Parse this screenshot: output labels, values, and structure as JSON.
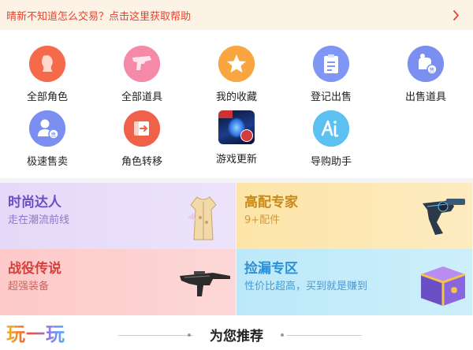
{
  "banner": {
    "text": "晴新不知道怎么交易？点击这里获取帮助",
    "icon": "chevron-right-icon"
  },
  "grid_items": [
    {
      "label": "全部角色",
      "icon": "character-icon",
      "color": "#f56a4a"
    },
    {
      "label": "全部道具",
      "icon": "gun-icon",
      "color": "#f48aa8"
    },
    {
      "label": "我的收藏",
      "icon": "star-icon",
      "color": "#f9a640"
    },
    {
      "label": "登记出售",
      "icon": "clipboard-icon",
      "color": "#7f96f4"
    },
    {
      "label": "出售道具",
      "icon": "bag-sell-icon",
      "color": "#7a8ff0"
    },
    {
      "label": "极速售卖",
      "icon": "user-sell-icon",
      "color": "#7a8ff0"
    },
    {
      "label": "角色转移",
      "icon": "transfer-icon",
      "color": "#f0614a"
    },
    {
      "label": "游戏更新",
      "icon": "game-thumbnail-icon",
      "color": "#1b3d8a"
    },
    {
      "label": "导购助手",
      "icon": "assistant-icon",
      "color": "#5cc0f1"
    }
  ],
  "cards": [
    {
      "title": "时尚达人",
      "subtitle": "走在潮流前线",
      "title_color": "#6c4cc7",
      "subtitle_color": "#8b79c9",
      "bg": "#e6dcf9",
      "art": "outfit-icon"
    },
    {
      "title": "高配专家",
      "subtitle": "9+配件",
      "title_color": "#c7891b",
      "subtitle_color": "#d19a42",
      "bg": "#fde7b3",
      "art": "revolver-icon"
    },
    {
      "title": "战役传说",
      "subtitle": "超强装备",
      "title_color": "#d8413b",
      "subtitle_color": "#d5635d",
      "bg": "#fdd0d0",
      "art": "rifle-icon"
    },
    {
      "title": "捡漏专区",
      "subtitle": "性价比超高，买到就是赚到",
      "title_color": "#2b8fd6",
      "subtitle_color": "#4b9ad1",
      "bg": "#bfeaf9",
      "art": "treasure-chest-icon"
    }
  ],
  "footer": {
    "logo_text": "玩一玩",
    "section_title": "为您推荐"
  }
}
